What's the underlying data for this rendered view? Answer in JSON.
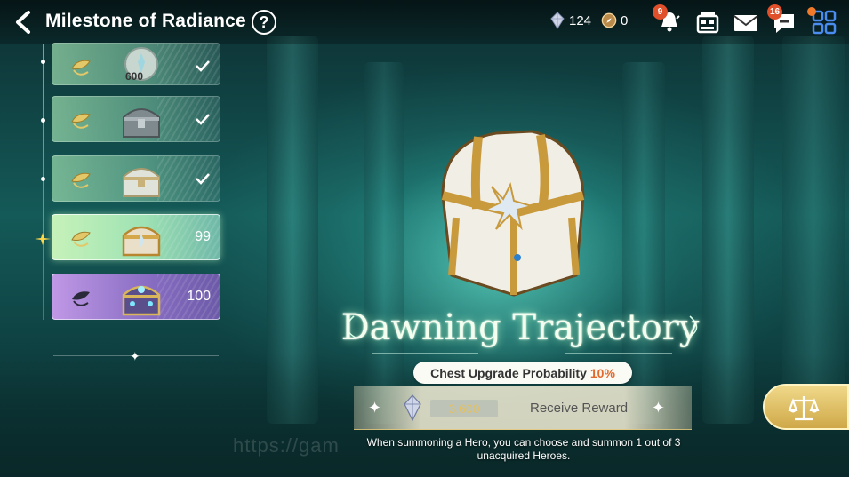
{
  "header": {
    "title": "Milestone of Radiance",
    "currencies": [
      {
        "icon": "crystal-icon",
        "value": "124"
      },
      {
        "icon": "compass-coin-icon",
        "value": "0"
      }
    ],
    "icons": [
      {
        "name": "notification-bell-icon",
        "badge": "9"
      },
      {
        "name": "shop-icon",
        "badge": ""
      },
      {
        "name": "mail-icon",
        "badge": ""
      },
      {
        "name": "chat-icon",
        "badge": "16"
      },
      {
        "name": "menu-grid-icon",
        "badge": ""
      }
    ]
  },
  "milestones": [
    {
      "item": "coin",
      "qty": "600",
      "status": "claimed"
    },
    {
      "item": "silver-chest",
      "qty": "",
      "status": "claimed"
    },
    {
      "item": "pearl-chest",
      "qty": "",
      "status": "claimed"
    },
    {
      "item": "gold-chest",
      "qty": "99",
      "status": "current"
    },
    {
      "item": "jeweled-chest",
      "qty": "100",
      "status": "locked"
    }
  ],
  "reward": {
    "title": "Dawning Trajectory",
    "probability_label": "Chest Upgrade Probability",
    "probability_value": "10%",
    "cost": "3,600",
    "receive_label": "Receive Reward",
    "description": "When summoning a Hero, you can choose and summon 1 out of 3 unacquired Heroes."
  },
  "watermark": "https://gam",
  "colors": {
    "accent_orange": "#e26a2c",
    "gold": "#e2c065",
    "active_green": "#c6f2b9",
    "locked_purple": "#8a6fc4"
  }
}
